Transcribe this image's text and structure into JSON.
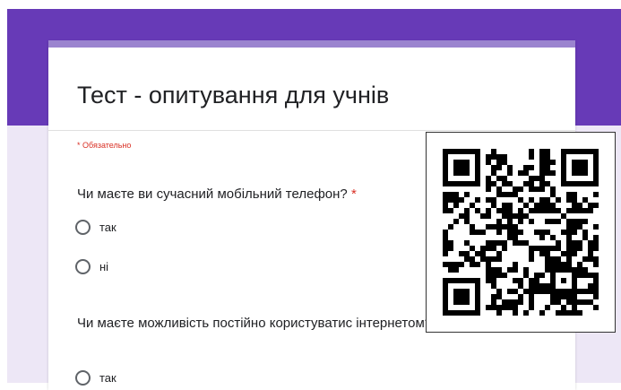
{
  "form": {
    "title": "Тест - опитування для учнів",
    "required_note": "* Обязательно",
    "questions": [
      {
        "text": "Чи маєте ви сучасний мобільний телефон?",
        "required_mark": "*",
        "options": [
          "так",
          "ні"
        ]
      },
      {
        "text": "Чи маєте можливість постійно користуватися інтернетом?",
        "visible_text": "Чи маєте можливість постійно користуватис інтернетом?",
        "required_mark": "*",
        "options": [
          "так"
        ]
      }
    ]
  },
  "overlay": {
    "qr_icon": "qr-code"
  },
  "colors": {
    "header_purple": "#673ab7",
    "card_accent": "#9b84cf",
    "page_background": "#ede7f6",
    "required_red": "#d93025"
  }
}
